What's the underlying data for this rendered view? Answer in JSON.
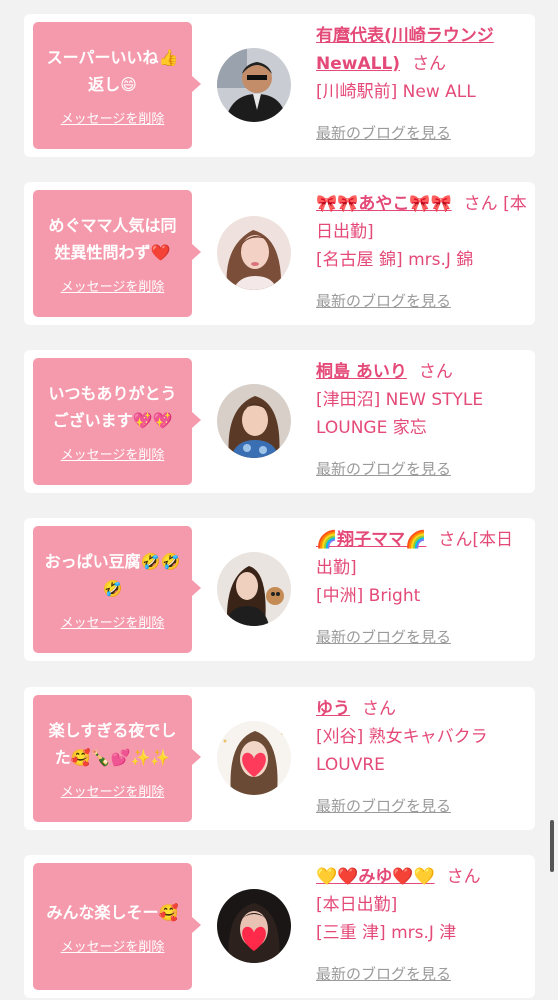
{
  "delete_label": "メッセージを削除",
  "blog_label": "最新のブログを見る",
  "san_label": "さん",
  "colors": {
    "accent": "#e44a78",
    "bubble": "#f59aac",
    "link_gray": "#9a9a9a"
  },
  "cards": [
    {
      "message": "スーパーいいね👍返し😄",
      "name": "有麿代表(川崎ラウンジNewALL)",
      "status": "",
      "shop": "[川崎駅前] New ALL",
      "avatar_icon": "man-photo"
    },
    {
      "message": "めぐママ人気は同姓異性問わず❤️",
      "name": "🎀🎀あやこ🎀🎀",
      "status": "[本日出勤]",
      "shop": "[名古屋 錦] mrs.J 錦",
      "avatar_icon": "woman-photo"
    },
    {
      "message": "いつもありがとうございます💖💖",
      "name": "桐島 あいり",
      "status": "",
      "shop": "[津田沼] NEW STYLE LOUNGE 家忘",
      "avatar_icon": "woman-photo"
    },
    {
      "message": "おっぱい豆腐🤣🤣🤣",
      "name": "🌈翔子ママ🌈",
      "status": "[本日出勤]",
      "shop": "[中洲] Bright",
      "avatar_icon": "woman-photo"
    },
    {
      "message": "楽しすぎる夜でした🥰🍾💕✨✨",
      "name": "ゆう",
      "status": "",
      "shop": "[刈谷] 熟女キャバクラ LOUVRE",
      "avatar_icon": "woman-photo-heart"
    },
    {
      "message": "みんな楽しそー🥰",
      "name": "💛❤️みゆ❤️💛",
      "status": "[本日出勤]",
      "shop": "[三重 津] mrs.J 津",
      "avatar_icon": "woman-photo-heart"
    }
  ]
}
